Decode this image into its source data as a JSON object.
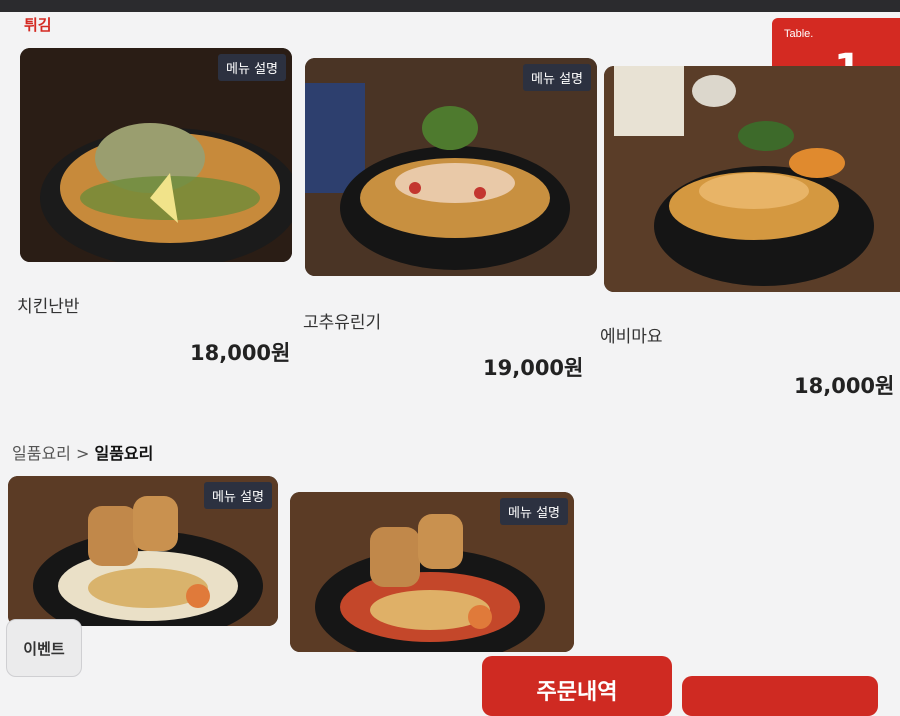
{
  "section": {
    "title": "튀김"
  },
  "table": {
    "label": "Table.",
    "number": "1"
  },
  "fried_items": [
    {
      "name": "치킨난반",
      "price": "18,000원",
      "desc_label": "메뉴 설명"
    },
    {
      "name": "고추유린기",
      "price": "19,000원",
      "desc_label": "메뉴 설명"
    },
    {
      "name": "에비마요",
      "price": "18,000원"
    }
  ],
  "breadcrumb": {
    "parent": "일품요리",
    "separator": ">",
    "current": "일품요리"
  },
  "dish_items": [
    {
      "desc_label": "메뉴 설명"
    },
    {
      "desc_label": "메뉴 설명"
    }
  ],
  "buttons": {
    "event": "이벤트",
    "order_history": "주문내역"
  },
  "colors": {
    "accent": "#d42a22",
    "desc_button": "#2c3140"
  }
}
